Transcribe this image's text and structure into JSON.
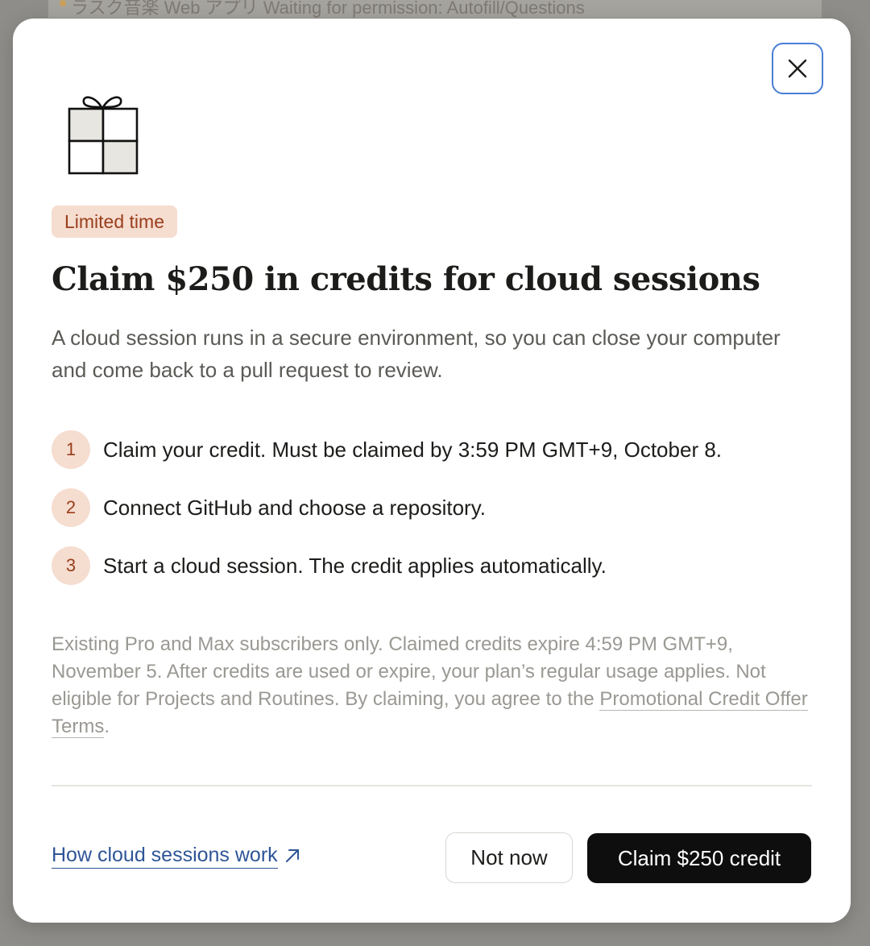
{
  "background": {
    "partial_text": "ラスク音楽 Web アプリ  Waiting for permission: Autofill/Questions"
  },
  "modal": {
    "badge": "Limited time",
    "title": "Claim $250 in credits for cloud sessions",
    "description": "A cloud session runs in a secure environment, so you can close your computer and come back to a pull request to review.",
    "steps": [
      {
        "num": "1",
        "text": "Claim your credit. Must be claimed by 3:59 PM GMT+9, October 8."
      },
      {
        "num": "2",
        "text": "Connect GitHub and choose a repository."
      },
      {
        "num": "3",
        "text": "Start a cloud session. The credit applies automatically."
      }
    ],
    "fineprint_before": "Existing Pro and Max subscribers only. Claimed credits expire 4:59 PM GMT+9, November 5. After credits are used or expire, your plan’s regular usage applies. Not eligible for Projects and Routines. By claiming, you agree to the ",
    "terms_link": "Promotional Credit Offer Terms",
    "fineprint_after": ".",
    "help_link": "How cloud sessions work",
    "not_now_label": "Not now",
    "claim_label": "Claim $250 credit"
  },
  "icons": {
    "close": "close-icon",
    "gift": "gift-icon",
    "external": "external-link-arrow-icon"
  },
  "colors": {
    "accent_badge_bg": "#f5ddd0",
    "accent_badge_text": "#9a3e1c",
    "link": "#2f5597",
    "primary_button": "#0e0e0e",
    "focus_ring": "#4a7fd6"
  }
}
